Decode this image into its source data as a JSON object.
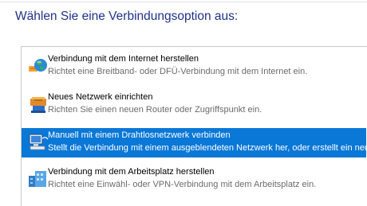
{
  "dialog": {
    "heading": "Wählen Sie eine Verbindungsoption aus:"
  },
  "options": [
    {
      "title": "Verbindung mit dem Internet herstellen",
      "description": "Richtet eine Breitband- oder DFÜ-Verbindung mit dem Internet ein.",
      "icon": "globe-network-icon",
      "selected": false
    },
    {
      "title": "Neues Netzwerk einrichten",
      "description": "Richten Sie einen neuen Router oder Zugriffspunkt ein.",
      "icon": "router-setup-icon",
      "selected": false
    },
    {
      "title": "Manuell mit einem Drahtlosnetzwerk verbinden",
      "description": "Stellt die Verbindung mit einem ausgeblendeten Netzwerk her, oder erstellt ein neue...",
      "icon": "wireless-network-icon",
      "selected": true
    },
    {
      "title": "Verbindung mit dem Arbeitsplatz herstellen",
      "description": "Richtet eine Einwähl- oder VPN-Verbindung mit dem Arbeitsplatz ein.",
      "icon": "workplace-connection-icon",
      "selected": false
    }
  ],
  "colors": {
    "heading": "#1e3287",
    "selection": "#0a78d7"
  }
}
